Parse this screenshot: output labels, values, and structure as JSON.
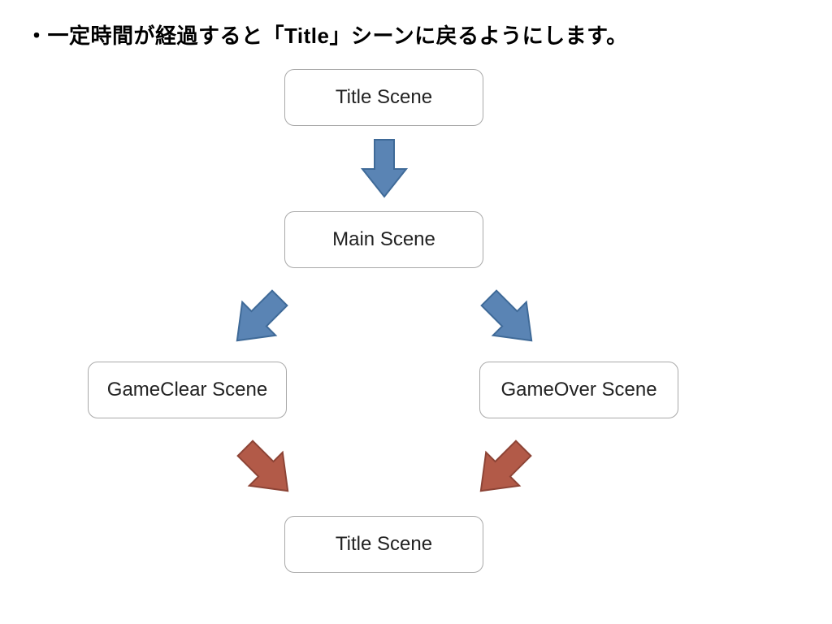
{
  "heading": "・一定時間が経過すると「Title」シーンに戻るようにします。",
  "nodes": {
    "title_top": "Title Scene",
    "main": "Main Scene",
    "gameclear": "GameClear Scene",
    "gameover": "GameOver Scene",
    "title_bot": "Title Scene"
  },
  "colors": {
    "arrow_blue_fill": "#5a84b4",
    "arrow_blue_stroke": "#3f6a98",
    "arrow_red_fill": "#b25a48",
    "arrow_red_stroke": "#8d4436",
    "node_border": "#a9a9a9"
  },
  "chart_data": {
    "type": "diagram",
    "title": "・一定時間が経過すると「Title」シーンに戻るようにします。",
    "nodes": [
      {
        "id": "title_top",
        "label": "Title Scene"
      },
      {
        "id": "main",
        "label": "Main Scene"
      },
      {
        "id": "gameclear",
        "label": "GameClear Scene"
      },
      {
        "id": "gameover",
        "label": "GameOver Scene"
      },
      {
        "id": "title_bot",
        "label": "Title Scene"
      }
    ],
    "edges": [
      {
        "from": "title_top",
        "to": "main",
        "color": "blue"
      },
      {
        "from": "main",
        "to": "gameclear",
        "color": "blue"
      },
      {
        "from": "main",
        "to": "gameover",
        "color": "blue"
      },
      {
        "from": "gameclear",
        "to": "title_bot",
        "color": "red"
      },
      {
        "from": "gameover",
        "to": "title_bot",
        "color": "red"
      }
    ]
  }
}
